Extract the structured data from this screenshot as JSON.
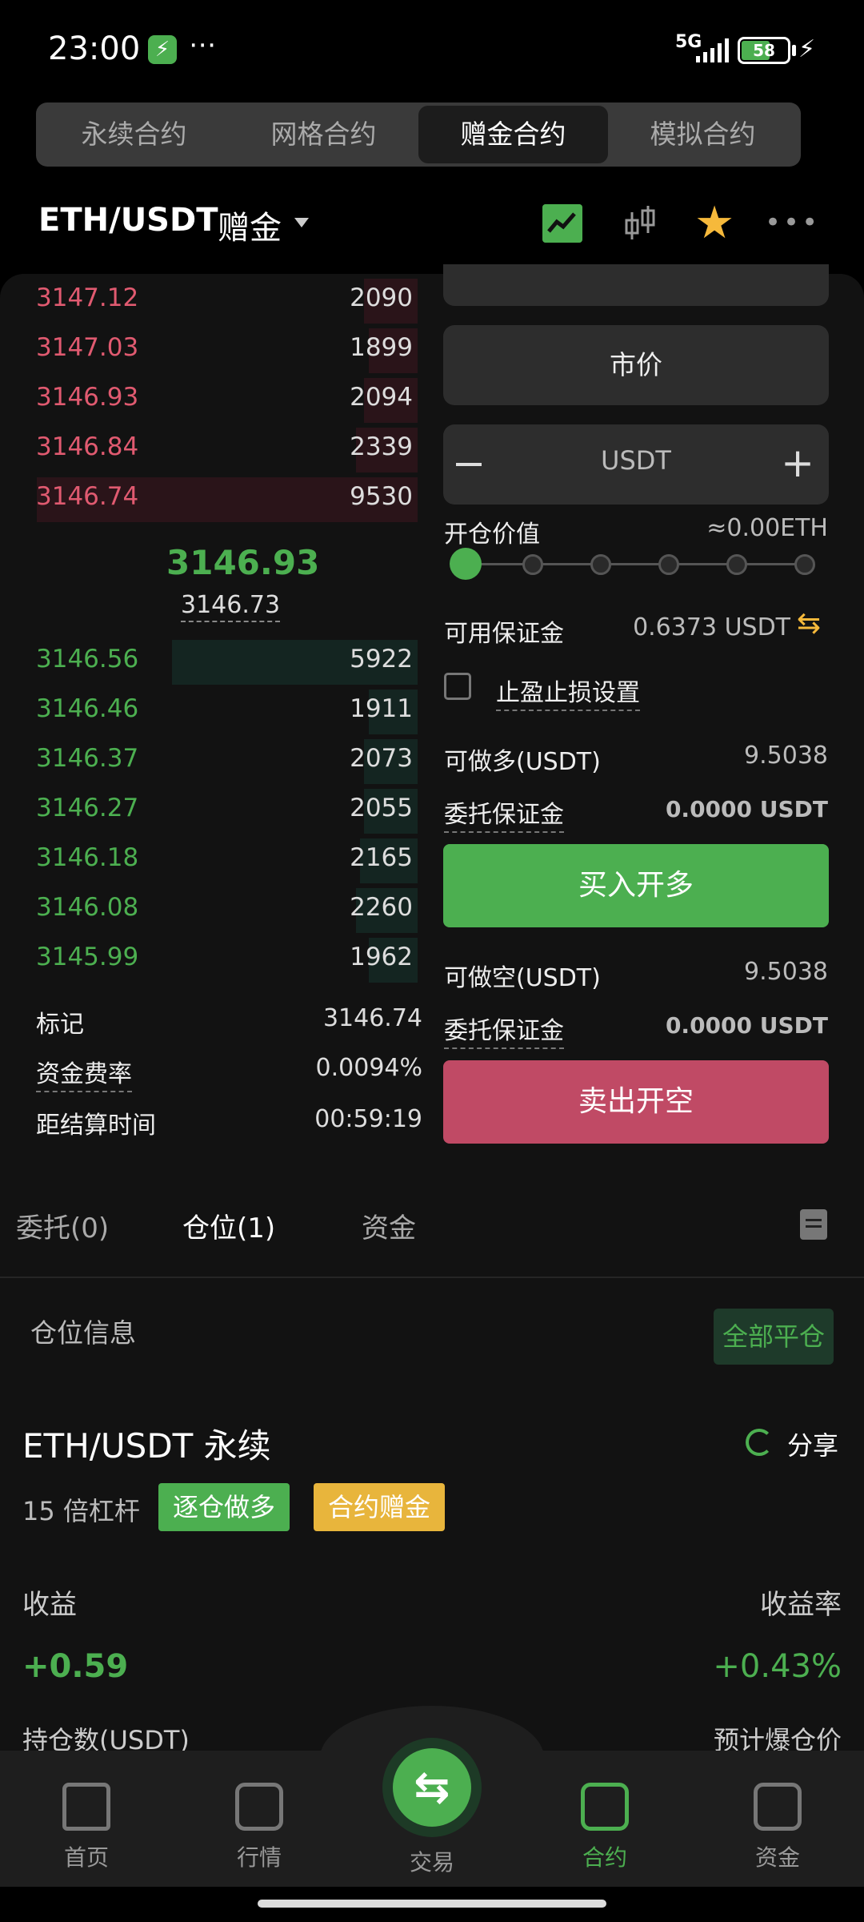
{
  "status_bar": {
    "time": "23:00",
    "more": "⋯",
    "network": "5G",
    "battery": "58"
  },
  "contract_tabs": [
    {
      "label": "永续合约",
      "active": false
    },
    {
      "label": "网格合约",
      "active": false
    },
    {
      "label": "赠金合约",
      "active": true
    },
    {
      "label": "模拟合约",
      "active": false
    }
  ],
  "header": {
    "pair": "ETH/USDT",
    "subtype": "赠金",
    "more": "•••",
    "star": "★"
  },
  "order_book": {
    "asks": [
      {
        "price": "3147.12",
        "qty": "2090",
        "depth": 0.13
      },
      {
        "price": "3147.03",
        "qty": "1899",
        "depth": 0.12
      },
      {
        "price": "3146.93",
        "qty": "2094",
        "depth": 0.13
      },
      {
        "price": "3146.84",
        "qty": "2339",
        "depth": 0.15
      },
      {
        "price": "3146.74",
        "qty": "9530",
        "depth": 0.93
      }
    ],
    "last_price": "3146.93",
    "mark_price": "3146.73",
    "bids": [
      {
        "price": "3146.56",
        "qty": "5922",
        "depth": 0.6
      },
      {
        "price": "3146.46",
        "qty": "1911",
        "depth": 0.12
      },
      {
        "price": "3146.37",
        "qty": "2073",
        "depth": 0.13
      },
      {
        "price": "3146.27",
        "qty": "2055",
        "depth": 0.13
      },
      {
        "price": "3146.18",
        "qty": "2165",
        "depth": 0.14
      },
      {
        "price": "3146.08",
        "qty": "2260",
        "depth": 0.15
      },
      {
        "price": "3145.99",
        "qty": "1962",
        "depth": 0.12
      }
    ],
    "info": [
      {
        "label": "标记",
        "value": "3146.74"
      },
      {
        "label": "资金费率",
        "value": "0.0094%"
      },
      {
        "label": "距结算时间",
        "value": "00:59:19"
      }
    ]
  },
  "order_form": {
    "order_type": "市价",
    "amount_unit": "USDT",
    "minus": "−",
    "plus": "+",
    "open_value_label": "开仓价值",
    "open_value": "≈0.00ETH",
    "slider_level": 0,
    "available_label": "可用保证金",
    "available_value": "0.6373 USDT",
    "tpsl_label": "止盈止损设置",
    "long_label": "可做多(USDT)",
    "long_value": "9.5038",
    "long_margin_label": "委托保证金",
    "long_margin_value": "0.0000 USDT",
    "buy_button": "买入开多",
    "short_label": "可做空(USDT)",
    "short_value": "9.5038",
    "short_margin_label": "委托保证金",
    "short_margin_value": "0.0000 USDT",
    "sell_button": "卖出开空"
  },
  "order_tabs": [
    {
      "label": "委托(0)",
      "active": false
    },
    {
      "label": "仓位(1)",
      "active": true
    },
    {
      "label": "资金",
      "active": false
    }
  ],
  "position": {
    "section_label": "仓位信息",
    "close_all": "全部平仓",
    "title": "ETH/USDT 永续",
    "share": "分享",
    "leverage": "15 倍杠杆",
    "tag_mode": "逐仓做多",
    "tag_bonus": "合约赠金",
    "pnl_label": "收益",
    "pnl_rate_label": "收益率",
    "pnl": "+0.59",
    "pnl_rate": "+0.43%",
    "hold_label": "持仓数(USDT)",
    "liq_label": "预计爆仓价"
  },
  "bottom_nav": [
    {
      "label": "首页",
      "icon": "home-icon",
      "active": false
    },
    {
      "label": "行情",
      "icon": "market-icon",
      "active": false
    },
    {
      "label": "交易",
      "icon": "trade-icon",
      "active": false
    },
    {
      "label": "合约",
      "icon": "contract-icon",
      "active": true
    },
    {
      "label": "资金",
      "icon": "wallet-icon",
      "active": false
    }
  ],
  "colors": {
    "green": "#4caf50",
    "red": "#e05a70",
    "gold": "#f6b93b",
    "sell": "#c04a65"
  }
}
